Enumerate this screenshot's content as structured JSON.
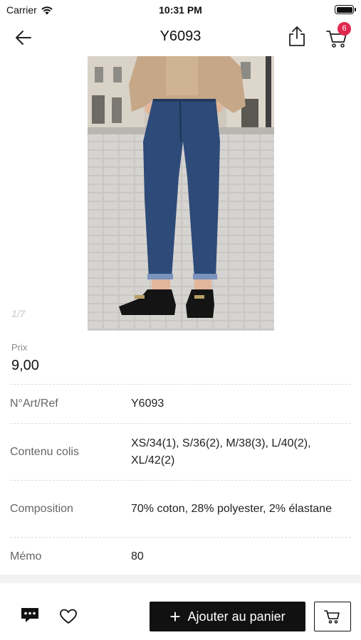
{
  "status_bar": {
    "carrier": "Carrier",
    "time": "10:31 PM"
  },
  "nav": {
    "title": "Y6093",
    "cart_count": "6"
  },
  "image": {
    "counter": "1/7"
  },
  "price": {
    "label": "Prix",
    "value": "9,00"
  },
  "details": [
    {
      "key": "N°Art/Ref",
      "value": "Y6093"
    },
    {
      "key": "Contenu colis",
      "value": "XS/34(1), S/36(2), M/38(3), L/40(2), XL/42(2)"
    },
    {
      "key": "Composition",
      "value": "70% coton, 28% polyester, 2% élastane"
    },
    {
      "key": "Mémo",
      "value": "80"
    }
  ],
  "bottom": {
    "add_to_cart_label": "Ajouter au panier"
  },
  "colors": {
    "accent": "#111111",
    "badge": "#e0284f"
  }
}
